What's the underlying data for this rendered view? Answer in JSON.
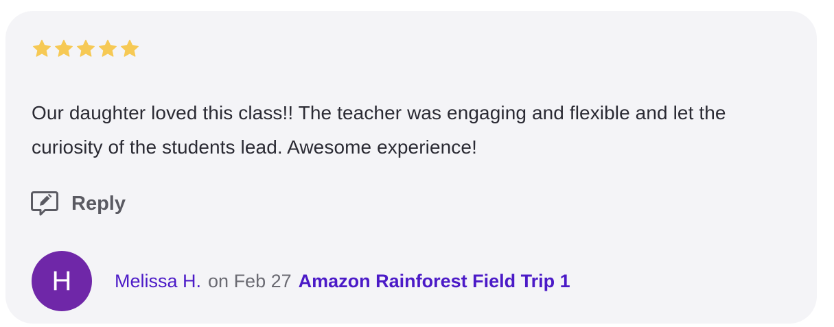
{
  "review": {
    "rating": 5,
    "rating_max": 5,
    "star_color": "#f6c955",
    "text": "Our daughter loved this class!! The teacher was engaging and flexible and let the curiosity of the students lead. Awesome experience!",
    "reply_label": "Reply",
    "reply_icon": "chat-edit-icon"
  },
  "author": {
    "initial": "H",
    "avatar_color": "#6f27a8",
    "name": "Melissa H.",
    "on_date": "on Feb 27",
    "class_name": "Amazon Rainforest Field Trip 1",
    "link_color": "#4b1ac7"
  }
}
